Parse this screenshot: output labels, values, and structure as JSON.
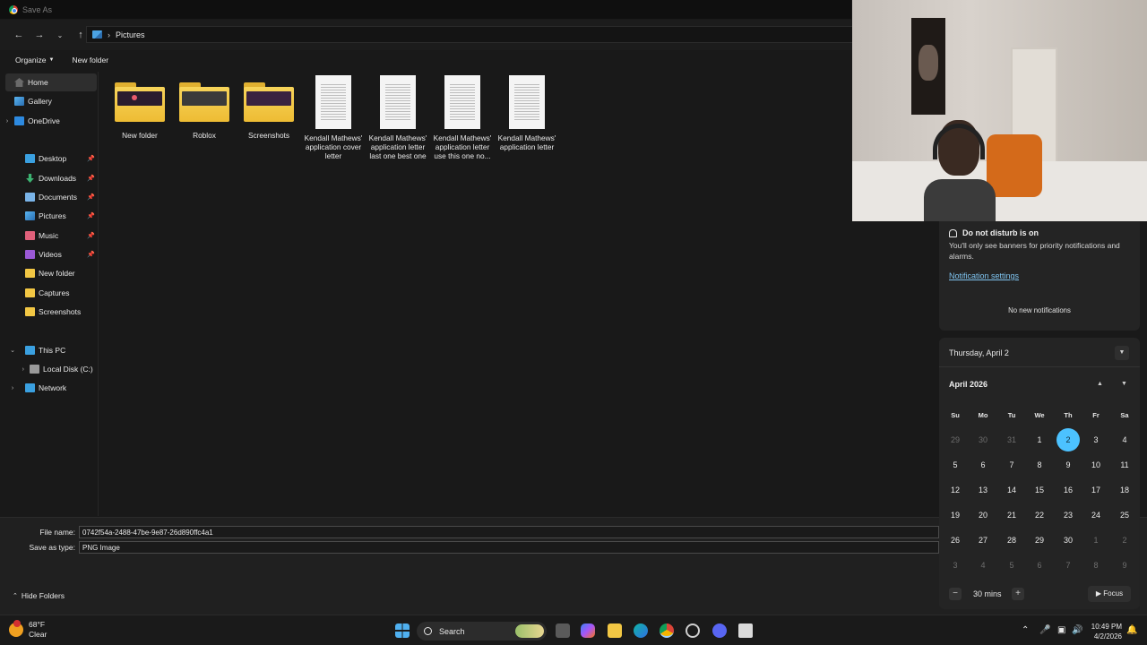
{
  "dialog": {
    "title": "Save As",
    "breadcrumb": "Pictures",
    "toolbar": {
      "organize": "Organize",
      "new_folder": "New folder"
    }
  },
  "sidebar": {
    "home": "Home",
    "gallery": "Gallery",
    "onedrive": "OneDrive",
    "desktop": "Desktop",
    "downloads": "Downloads",
    "documents": "Documents",
    "pictures": "Pictures",
    "music": "Music",
    "videos": "Videos",
    "new_folder": "New folder",
    "captures": "Captures",
    "screenshots": "Screenshots",
    "this_pc": "This PC",
    "local_disk": "Local Disk (C:)",
    "network": "Network"
  },
  "files": [
    {
      "name": "New folder",
      "type": "folder"
    },
    {
      "name": "Roblox",
      "type": "folder"
    },
    {
      "name": "Screenshots",
      "type": "folder"
    },
    {
      "name": "Kendall Mathews' application cover letter",
      "type": "document"
    },
    {
      "name": "Kendall Mathews' application letter last one best one",
      "type": "document"
    },
    {
      "name": "Kendall Mathews' application letter use this one no...",
      "type": "document"
    },
    {
      "name": "Kendall Mathews' application letter",
      "type": "document"
    }
  ],
  "save": {
    "file_name_label": "File name:",
    "file_name_value": "0742f54a-2488-47be-9e87-26d890ffc4a1",
    "type_label": "Save as type:",
    "type_value": "PNG Image",
    "hide_folders": "Hide Folders"
  },
  "notifications": {
    "dnd_title": "Do not disturb is on",
    "dnd_message": "You'll only see banners for priority notifications and alarms.",
    "settings_link": "Notification settings",
    "empty": "No new notifications"
  },
  "calendar": {
    "date_header": "Thursday, April 2",
    "month": "April 2026",
    "weekdays": [
      "Su",
      "Mo",
      "Tu",
      "We",
      "Th",
      "Fr",
      "Sa"
    ],
    "weeks": [
      [
        "29",
        "30",
        "31",
        "1",
        "2",
        "3",
        "4"
      ],
      [
        "5",
        "6",
        "7",
        "8",
        "9",
        "10",
        "11"
      ],
      [
        "12",
        "13",
        "14",
        "15",
        "16",
        "17",
        "18"
      ],
      [
        "19",
        "20",
        "21",
        "22",
        "23",
        "24",
        "25"
      ],
      [
        "26",
        "27",
        "28",
        "29",
        "30",
        "1",
        "2"
      ],
      [
        "3",
        "4",
        "5",
        "6",
        "7",
        "8",
        "9"
      ]
    ],
    "today": "2",
    "focus_minutes": "30 mins",
    "focus_label": "Focus"
  },
  "taskbar": {
    "temperature": "68°F",
    "condition": "Clear",
    "search": "Search",
    "time": "10:49 PM",
    "date": "4/2/2026"
  },
  "colors": {
    "accent": "#4cc2ff",
    "folder": "#f2c744",
    "link": "#7fc4f0"
  }
}
